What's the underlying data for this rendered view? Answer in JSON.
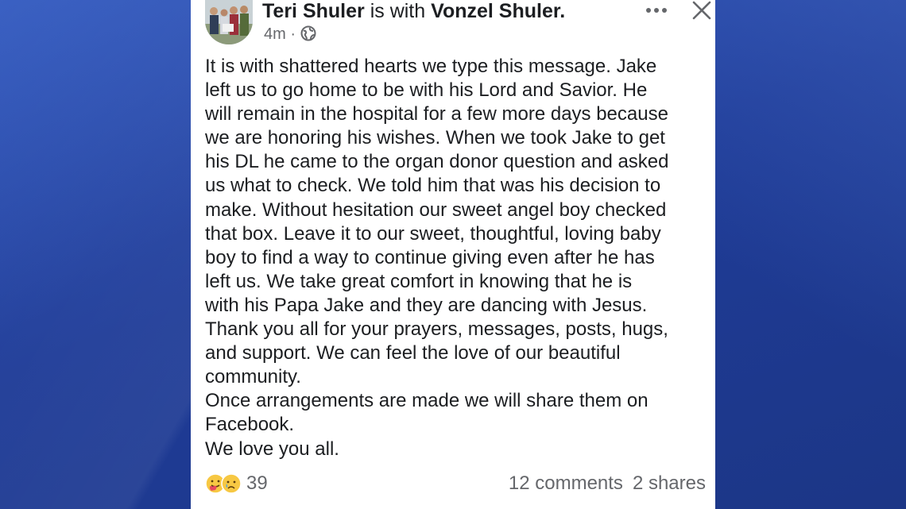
{
  "colors": {
    "background": "#213f9a",
    "card": "#ffffff",
    "text_primary": "#1c1e21",
    "text_secondary": "#65676b"
  },
  "post": {
    "author": "Teri Shuler",
    "with_text": "is with",
    "tagged": "Vonzel Shuler.",
    "time": "4m",
    "separator": "·",
    "audience_icon": "globe-icon",
    "menu_icon": "more-dots-icon",
    "close_icon": "close-icon",
    "body_lines": [
      "It is with shattered hearts we type this message. Jake",
      "left us to go home to be with his Lord and Savior. He",
      "will remain in the hospital for a few more days because",
      "we are honoring his wishes. When we took Jake to get",
      "his DL he came to the organ donor question and asked",
      "us what to check. We told him that was his decision to",
      "make. Without hesitation our sweet angel boy checked",
      "that box. Leave it to our sweet, thoughtful, loving baby",
      "boy to find a way to continue giving even after he has",
      "left us. We take great comfort in knowing that he is",
      "with his Papa Jake and they are dancing with Jesus.",
      "Thank you all for your prayers, messages, posts, hugs,",
      "and support. We can feel the love of our beautiful",
      "community.",
      "Once arrangements are made we will share them on",
      "Facebook.",
      "We love you all."
    ],
    "reactions": {
      "icons": [
        "care-reaction-icon",
        "sad-reaction-icon"
      ],
      "count": "39"
    },
    "comments": "12 comments",
    "shares": "2 shares"
  }
}
